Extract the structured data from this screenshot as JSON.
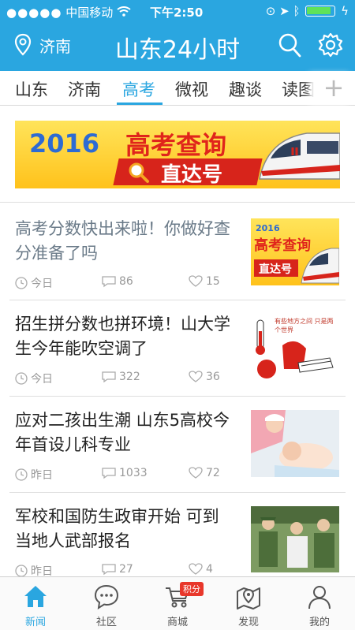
{
  "status": {
    "carrier": "中国移动",
    "time": "下午2:50"
  },
  "header": {
    "location": "济南",
    "title": "山东24小时"
  },
  "tabs": [
    {
      "label": "山东"
    },
    {
      "label": "济南"
    },
    {
      "label": "高考",
      "active": true
    },
    {
      "label": "微视"
    },
    {
      "label": "趣谈"
    },
    {
      "label": "读图"
    }
  ],
  "tabs_more": "+",
  "banner": {
    "year": "2016",
    "headline": "高考查询",
    "sub": "直达号"
  },
  "news": [
    {
      "title": "高考分数快出来啦！你做好查分准备了吗",
      "time": "今日",
      "comments": "86",
      "likes": "15",
      "read": true,
      "thumb": {
        "year": "2016",
        "headline": "高考查询",
        "sub": "直达号"
      }
    },
    {
      "title": "招生拼分数也拼环境！山大学生今年能吹空调了",
      "time": "今日",
      "comments": "322",
      "likes": "36",
      "read": false,
      "thumb": {
        "caption": "有些地方之间 只是两个世界"
      }
    },
    {
      "title": "应对二孩出生潮 山东5高校今年首设儿科专业",
      "time": "昨日",
      "comments": "1033",
      "likes": "72",
      "read": false
    },
    {
      "title": "军校和国防生政审开始 可到当地人武部报名",
      "time": "昨日",
      "comments": "27",
      "likes": "4",
      "read": false
    }
  ],
  "bottom_nav": [
    {
      "label": "新闻",
      "icon": "home-icon",
      "active": true
    },
    {
      "label": "社区",
      "icon": "chat-bubble-icon"
    },
    {
      "label": "商城",
      "icon": "cart-icon",
      "badge": "积分"
    },
    {
      "label": "发现",
      "icon": "map-pin-icon"
    },
    {
      "label": "我的",
      "icon": "person-icon"
    }
  ],
  "colors": {
    "brand": "#2aa6e0",
    "badge": "#e8372b"
  }
}
